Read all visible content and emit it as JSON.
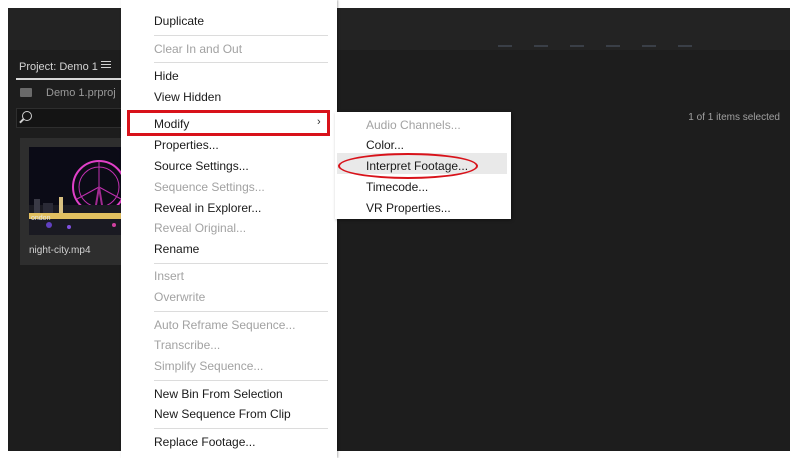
{
  "panel": {
    "title": "Project: Demo 1",
    "bin_name": "Demo 1.prproj",
    "selection_status": "1 of 1 items selected",
    "clip_name": "night-city.mp4",
    "thumb_caption": "ondon"
  },
  "context_menu": {
    "items": [
      {
        "label": "Duplicate",
        "enabled": true
      },
      {
        "label": "Clear In and Out",
        "enabled": false
      },
      {
        "label": "Hide",
        "enabled": true
      },
      {
        "label": "View Hidden",
        "enabled": true
      },
      {
        "label": "Modify",
        "enabled": true,
        "has_submenu": true
      },
      {
        "label": "Properties...",
        "enabled": true
      },
      {
        "label": "Source Settings...",
        "enabled": true
      },
      {
        "label": "Sequence Settings...",
        "enabled": false
      },
      {
        "label": "Reveal in Explorer...",
        "enabled": true
      },
      {
        "label": "Reveal Original...",
        "enabled": false
      },
      {
        "label": "Rename",
        "enabled": true
      },
      {
        "label": "Insert",
        "enabled": false
      },
      {
        "label": "Overwrite",
        "enabled": false
      },
      {
        "label": "Auto Reframe Sequence...",
        "enabled": false
      },
      {
        "label": "Transcribe...",
        "enabled": false
      },
      {
        "label": "Simplify Sequence...",
        "enabled": false
      },
      {
        "label": "New Bin From Selection",
        "enabled": true
      },
      {
        "label": "New Sequence From Clip",
        "enabled": true
      },
      {
        "label": "Replace Footage...",
        "enabled": true
      }
    ],
    "submenu_arrow": "›"
  },
  "submenu": {
    "items": [
      {
        "label": "Audio Channels...",
        "enabled": false
      },
      {
        "label": "Color...",
        "enabled": true
      },
      {
        "label": "Interpret Footage...",
        "enabled": true
      },
      {
        "label": "Timecode...",
        "enabled": true
      },
      {
        "label": "VR Properties...",
        "enabled": true
      }
    ]
  },
  "colors": {
    "highlight": "#d8121a",
    "panel_bg": "#1d1d1d",
    "menu_bg": "#ffffff",
    "disabled_text": "#a2a2a2"
  }
}
